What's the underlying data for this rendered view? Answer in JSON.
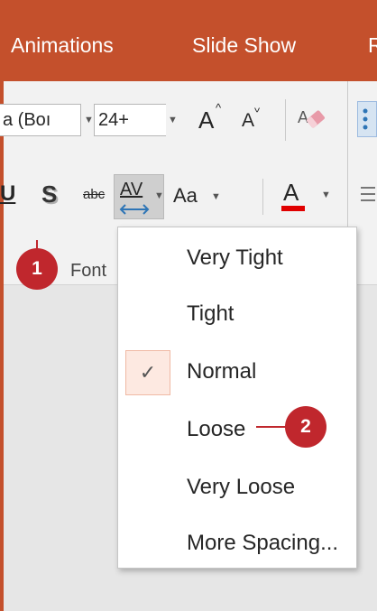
{
  "tabs": {
    "animations": "Animations",
    "slide_show": "Slide Show",
    "next_tab": "R"
  },
  "font": {
    "name_value": "a (Boı",
    "size_value": "24+"
  },
  "ribbon": {
    "grow_font_label": "A",
    "shrink_font_label": "A",
    "shadow_label": "S",
    "strikethrough_label": "abc",
    "char_spacing_label": "AV",
    "change_case_label": "Aa",
    "font_color_label": "A",
    "underline_label": "U",
    "group_label": "Font"
  },
  "spacing_menu": {
    "items": [
      {
        "label": "Very Tight",
        "checked": false
      },
      {
        "label": "Tight",
        "checked": false
      },
      {
        "label": "Normal",
        "checked": true
      },
      {
        "label": "Loose",
        "checked": false
      },
      {
        "label": "Very Loose",
        "checked": false
      },
      {
        "label": "More Spacing...",
        "checked": false
      }
    ],
    "check_mark": "✓"
  },
  "callouts": {
    "one": "1",
    "two": "2"
  },
  "colors": {
    "ribbon_tab_bar": "#c4502c",
    "font_color_bar": "#e00000",
    "callout": "#c0272d",
    "spacing_arrow": "#2e75b6"
  },
  "icons": [
    "eraser-icon",
    "bullets-icon",
    "align-icon",
    "dropdown-arrow-icon",
    "check-icon"
  ]
}
